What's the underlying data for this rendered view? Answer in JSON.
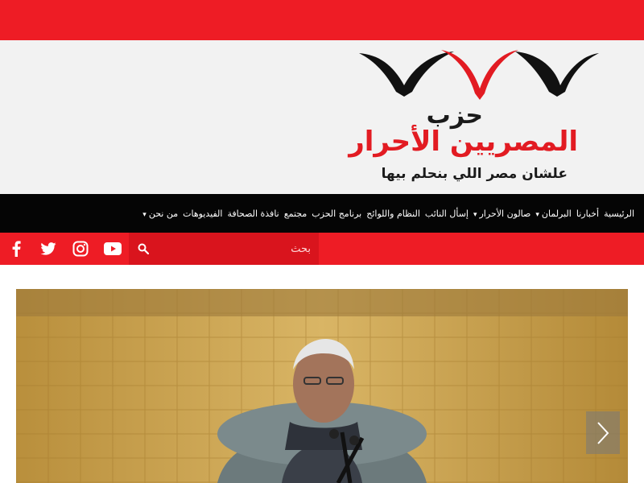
{
  "header": {
    "brand_line1": "حزب",
    "brand_line2": "المصريين الأحرار",
    "slogan": "علشان مصر اللي بنحلم بيها"
  },
  "nav": {
    "items": [
      {
        "label": "الرئيسية",
        "has_dropdown": false
      },
      {
        "label": "أخبارنا",
        "has_dropdown": false
      },
      {
        "label": "البرلمان",
        "has_dropdown": true
      },
      {
        "label": "صالون الأحرار",
        "has_dropdown": true
      },
      {
        "label": "إسأل النائب",
        "has_dropdown": false
      },
      {
        "label": "النظام واللوائح",
        "has_dropdown": false
      },
      {
        "label": "برنامج الحزب",
        "has_dropdown": false
      },
      {
        "label": "مجتمع",
        "has_dropdown": false
      },
      {
        "label": "نافذة الصحافة",
        "has_dropdown": false
      },
      {
        "label": "الفيديوهات",
        "has_dropdown": false
      },
      {
        "label": "من نحن",
        "has_dropdown": true
      }
    ],
    "caret": "▾"
  },
  "search": {
    "placeholder": "بحث"
  },
  "social": [
    "facebook-icon",
    "twitter-icon",
    "instagram-icon",
    "youtube-icon"
  ],
  "colors": {
    "brand_red": "#ee1c25",
    "nav_black": "#050505",
    "header_bg": "#f2f2f2"
  }
}
